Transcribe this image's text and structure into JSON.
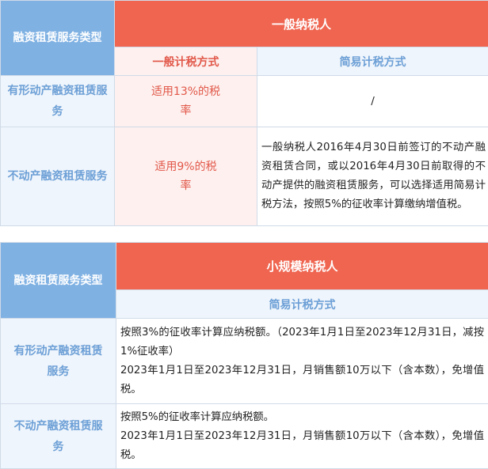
{
  "table1": {
    "type_header": "融资租赁服务类型",
    "payer_header": "一般纳税人",
    "method_general": "一般计税方式",
    "method_simple": "简易计税方式",
    "rows": [
      {
        "label": "有形动产融资租赁服务",
        "general": "适用13%的税率",
        "simple": "/"
      },
      {
        "label": "不动产融资租赁服务",
        "general": "适用9%的税率",
        "simple": "一般纳税人2016年4月30日前签订的不动产融资租赁合同，或以2016年4月30日前取得的不动产提供的融资租赁服务，可以选择适用简易计税方法，按照5%的征收率计算缴纳增值税。"
      }
    ]
  },
  "table2": {
    "type_header": "融资租赁服务类型",
    "payer_header": "小规模纳税人",
    "method_simple": "简易计税方式",
    "rows": [
      {
        "label": "有形动产融资租赁服务",
        "line1": "按照3%的征收率计算应纳税额。（2023年1月1日至2023年12月31日，减按1%征收率）",
        "line2": "2023年1月1日至2023年12月31日，月销售额10万以下（含本数），免增值税。"
      },
      {
        "label": "不动产融资租赁服务",
        "line1": "按照5%的征收率计算应纳税额。",
        "line2": "2023年1月1日至2023年12月31日，月销售额10万以下（含本数），免增值税。"
      }
    ]
  }
}
